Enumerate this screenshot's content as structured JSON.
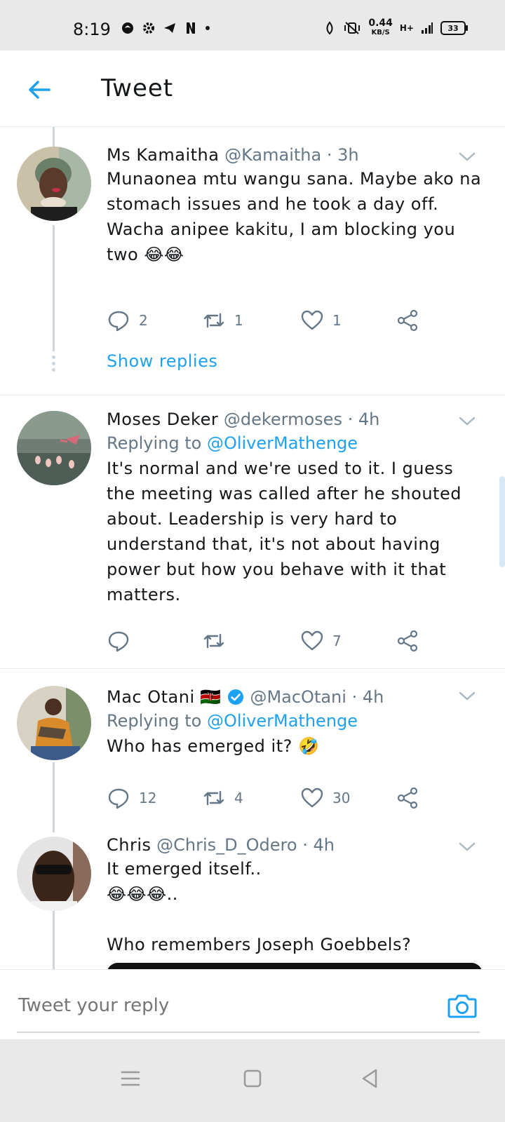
{
  "status_bar": {
    "time": "8:19",
    "net_speed": "0.44",
    "net_unit": "KB/S",
    "network_type": "H+",
    "battery": "33"
  },
  "header": {
    "title": "Tweet"
  },
  "tweets": [
    {
      "name": "Ms Kamaitha",
      "handle": "@Kamaitha",
      "time": "3h",
      "text": "Munaonea mtu wangu sana. Maybe ako na stomach issues and he took a day off.\nWacha anipee kakitu, I am blocking you two 😂😂",
      "replies": "2",
      "retweets": "1",
      "likes": "1",
      "show_replies": "Show replies"
    },
    {
      "name": "Moses Deker",
      "handle": "@dekermoses",
      "time": "4h",
      "replying_prefix": "Replying to",
      "replying_to": "@OliverMathenge",
      "text": "It's normal and we're used to it. I guess the meeting was called after he shouted about. Leadership is very hard to understand that, it's not about having power but how you behave with it that matters.",
      "replies": "",
      "retweets": "",
      "likes": "7"
    },
    {
      "name": "Mac Otani",
      "flag": "🇰🇪",
      "handle": "@MacOtani",
      "time": "4h",
      "replying_prefix": "Replying to",
      "replying_to": "@OliverMathenge",
      "text": "Who has emerged it? 🤣",
      "replies": "12",
      "retweets": "4",
      "likes": "30"
    },
    {
      "name": "Chris",
      "handle": "@Chris_D_Odero",
      "time": "4h",
      "text": "It emerged itself..\n😂😂😂..\n\nWho remembers Joseph Goebbels?"
    }
  ],
  "reply_bar": {
    "placeholder": "Tweet your reply"
  },
  "colors": {
    "accent": "#1da1f2",
    "muted": "#657786",
    "text": "#14171a",
    "divider": "#e6ecf0"
  }
}
